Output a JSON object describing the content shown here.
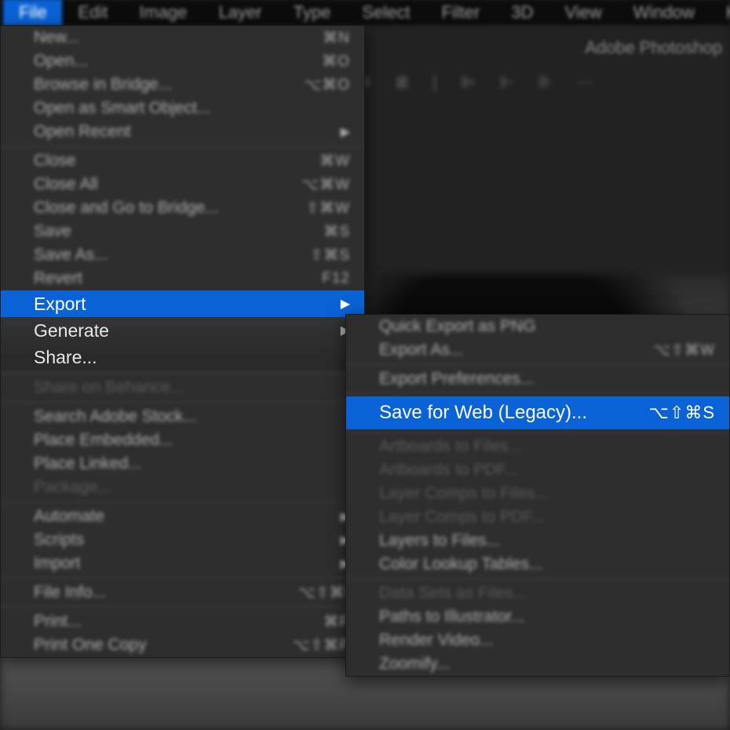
{
  "app_title": "Adobe Photoshop",
  "menubar": [
    "File",
    "Edit",
    "Image",
    "Layer",
    "Type",
    "Select",
    "Filter",
    "3D",
    "View",
    "Window",
    "Help"
  ],
  "menu1": {
    "groups": [
      [
        {
          "label": "New...",
          "sc": "⌘N"
        },
        {
          "label": "Open...",
          "sc": "⌘O"
        },
        {
          "label": "Browse in Bridge...",
          "sc": "⌥⌘O"
        },
        {
          "label": "Open as Smart Object..."
        },
        {
          "label": "Open Recent",
          "arrow": true
        }
      ],
      [
        {
          "label": "Close",
          "sc": "⌘W"
        },
        {
          "label": "Close All",
          "sc": "⌥⌘W"
        },
        {
          "label": "Close and Go to Bridge...",
          "sc": "⇧⌘W"
        },
        {
          "label": "Save",
          "sc": "⌘S"
        },
        {
          "label": "Save As...",
          "sc": "⇧⌘S"
        },
        {
          "label": "Revert",
          "sc": "F12"
        }
      ],
      "SHARP",
      [
        {
          "label": "Share on Behance...",
          "disabled": true
        }
      ],
      [
        {
          "label": "Search Adobe Stock..."
        },
        {
          "label": "Place Embedded..."
        },
        {
          "label": "Place Linked..."
        },
        {
          "label": "Package...",
          "disabled": true
        }
      ],
      [
        {
          "label": "Automate",
          "arrow": true
        },
        {
          "label": "Scripts",
          "arrow": true
        },
        {
          "label": "Import",
          "arrow": true
        }
      ],
      [
        {
          "label": "File Info...",
          "sc": "⌥⇧⌘I"
        }
      ],
      [
        {
          "label": "Print...",
          "sc": "⌘P"
        },
        {
          "label": "Print One Copy",
          "sc": "⌥⇧⌘P"
        }
      ]
    ],
    "sharp": [
      {
        "label": "Export",
        "arrow": true,
        "hl": true
      },
      {
        "label": "Generate",
        "arrow": true
      },
      {
        "label": "Share..."
      }
    ]
  },
  "menu2": {
    "groups": [
      [
        {
          "label": "Quick Export as PNG"
        },
        {
          "label": "Export As...",
          "sc": "⌥⇧⌘W"
        }
      ],
      [
        {
          "label": "Export Preferences..."
        }
      ],
      "SFW",
      [
        {
          "label": "Artboards to Files...",
          "disabled": true
        },
        {
          "label": "Artboards to PDF...",
          "disabled": true
        },
        {
          "label": "Layer Comps to Files...",
          "disabled": true
        },
        {
          "label": "Layer Comps to PDF...",
          "disabled": true
        },
        {
          "label": "Layers to Files..."
        },
        {
          "label": "Color Lookup Tables..."
        }
      ],
      [
        {
          "label": "Data Sets as Files...",
          "disabled": true
        },
        {
          "label": "Paths to Illustrator..."
        },
        {
          "label": "Render Video..."
        },
        {
          "label": "Zoomify..."
        }
      ]
    ],
    "sfw": {
      "label": "Save for Web (Legacy)...",
      "sc": "⌥⇧⌘S"
    }
  }
}
